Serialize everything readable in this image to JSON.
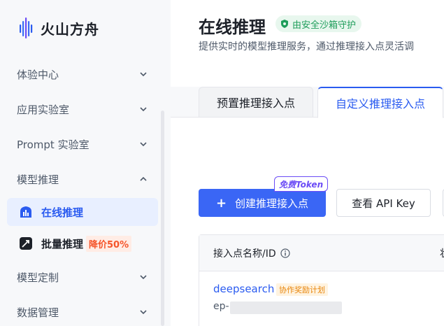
{
  "app": {
    "name": "火山方舟"
  },
  "sidebar": {
    "items": [
      {
        "label": "体验中心"
      },
      {
        "label": "应用实验室"
      },
      {
        "label": "Prompt 实验室"
      },
      {
        "label": "模型推理"
      },
      {
        "label": "模型定制"
      },
      {
        "label": "数据管理"
      }
    ],
    "sub_items": [
      {
        "label": "在线推理",
        "icon": "bar-chart-icon"
      },
      {
        "label": "批量推理",
        "icon": "rocket-icon",
        "badge": "降价50%"
      }
    ]
  },
  "page": {
    "title": "在线推理",
    "secure_badge": "由安全沙箱守护",
    "description": "提供实时的模型推理服务，通过推理接入点灵活调"
  },
  "tabs": [
    {
      "label": "预置推理接入点"
    },
    {
      "label": "自定义推理接入点"
    }
  ],
  "toolbar": {
    "create_label": "创建推理接入点",
    "create_tag": "免费Token",
    "apikey_label": "查看 API Key"
  },
  "table": {
    "columns": [
      "接入点名称/ID",
      "状"
    ],
    "rows": [
      {
        "name": "deepsearch",
        "tag": "协作奖励计划",
        "id_prefix": "ep-"
      }
    ]
  },
  "colors": {
    "accent": "#3a66f5",
    "active_bg": "#e8efff",
    "sidebar_bg": "#f7f8fa",
    "secure_green": "#1e9d5a",
    "discount_red": "#f5542a"
  }
}
